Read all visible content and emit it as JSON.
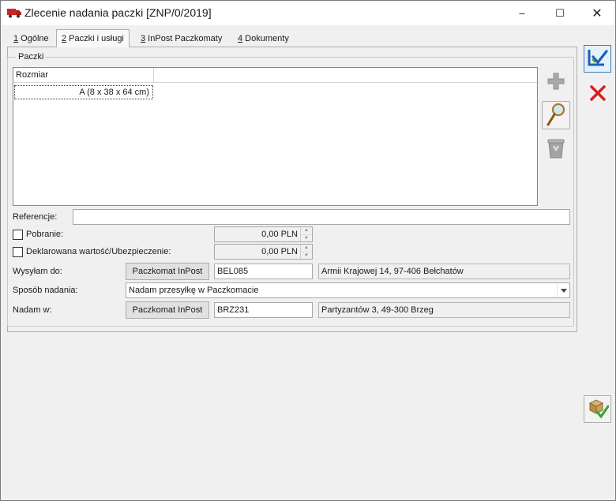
{
  "window": {
    "title": "Zlecenie nadania paczki [ZNP/0/2019]",
    "icon": "delivery-truck-icon",
    "controls": {
      "minimize": "–",
      "maximize": "☐",
      "close": "✕"
    }
  },
  "tabs": [
    {
      "key": "1",
      "label": " Ogólne"
    },
    {
      "key": "2",
      "label": " Paczki i usługi"
    },
    {
      "key": "3",
      "label": " InPost Paczkomaty"
    },
    {
      "key": "4",
      "label": " Dokumenty"
    }
  ],
  "packages": {
    "group_label": "Paczki",
    "columns": [
      "Rozmiar",
      ""
    ],
    "rows": [
      {
        "size": "A (8 x 38 x 64 cm)"
      }
    ],
    "actions": [
      "add-icon",
      "magnifier-icon",
      "trash-icon"
    ]
  },
  "form": {
    "reference": {
      "label": "Referencje:",
      "value": ""
    },
    "cod": {
      "label": "Pobranie:",
      "checked": false,
      "value": "0,00 PLN"
    },
    "declared": {
      "label": "Deklarowana wartość/Ubezpieczenie:",
      "checked": false,
      "value": "0,00 PLN"
    },
    "send_to": {
      "label": "Wysyłam do:",
      "button": "Paczkomat InPost",
      "code": "BEL085",
      "address": "Armii Krajowej 14, 97-406 Bełchatów"
    },
    "method": {
      "label": "Sposób nadania:",
      "value": "Nadam przesyłkę w Paczkomacie"
    },
    "send_from": {
      "label": "Nadam w:",
      "button": "Paczkomat InPost",
      "code": "BRZ231",
      "address": "Partyzantów 3, 49-300 Brzeg"
    }
  },
  "right_toolbar": {
    "save": "save-icon",
    "cancel": "cancel-icon",
    "send": "send-package-icon"
  },
  "colors": {
    "cancel_red": "#d62020",
    "save_blue": "#1f5fb5",
    "check_green": "#3aa335",
    "truck_red": "#c62828"
  }
}
